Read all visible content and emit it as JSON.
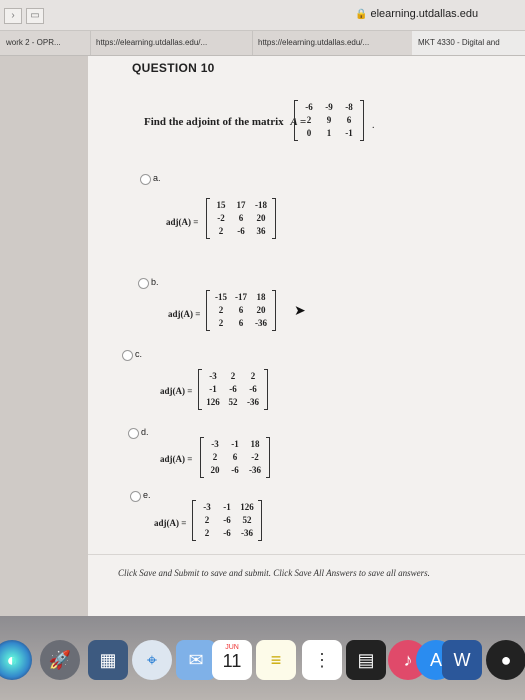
{
  "browser": {
    "url": "elearning.utdallas.edu",
    "tabs": [
      "work 2 - OPR...",
      "https://elearning.utdallas.edu/...",
      "https://elearning.utdallas.edu/...",
      "MKT 4330 - Digital and"
    ]
  },
  "question": {
    "title": "QUESTION 10",
    "prompt": "Find the adjoint of the matrix",
    "var": "A =",
    "matrix": [
      [
        "-6",
        "-9",
        "-8"
      ],
      [
        "2",
        "9",
        "6"
      ],
      [
        "0",
        "1",
        "-1"
      ]
    ]
  },
  "options": [
    {
      "letter": "a.",
      "label": "adj(A) =",
      "matrix": [
        [
          "15",
          "17",
          "-18"
        ],
        [
          "-2",
          "6",
          "20"
        ],
        [
          "2",
          "-6",
          "36"
        ]
      ]
    },
    {
      "letter": "b.",
      "label": "adj(A) =",
      "matrix": [
        [
          "-15",
          "-17",
          "18"
        ],
        [
          "2",
          "6",
          "20"
        ],
        [
          "2",
          "6",
          "-36"
        ]
      ]
    },
    {
      "letter": "c.",
      "label": "adj(A) =",
      "matrix": [
        [
          "-3",
          "2",
          "2"
        ],
        [
          "-1",
          "-6",
          "-6"
        ],
        [
          "126",
          "52",
          "-36"
        ]
      ]
    },
    {
      "letter": "d.",
      "label": "adj(A) =",
      "matrix": [
        [
          "-3",
          "-1",
          "18"
        ],
        [
          "2",
          "6",
          "-2"
        ],
        [
          "20",
          "-6",
          "-36"
        ]
      ]
    },
    {
      "letter": "e.",
      "label": "adj(A) =",
      "matrix": [
        [
          "-3",
          "-1",
          "126"
        ],
        [
          "2",
          "-6",
          "52"
        ],
        [
          "2",
          "-6",
          "-36"
        ]
      ]
    }
  ],
  "footer": "Click Save and Submit to save and submit. Click Save All Answers to save all answers.",
  "dock": {
    "calendar_month": "JUN",
    "calendar_day": "11",
    "word_label": "W"
  }
}
